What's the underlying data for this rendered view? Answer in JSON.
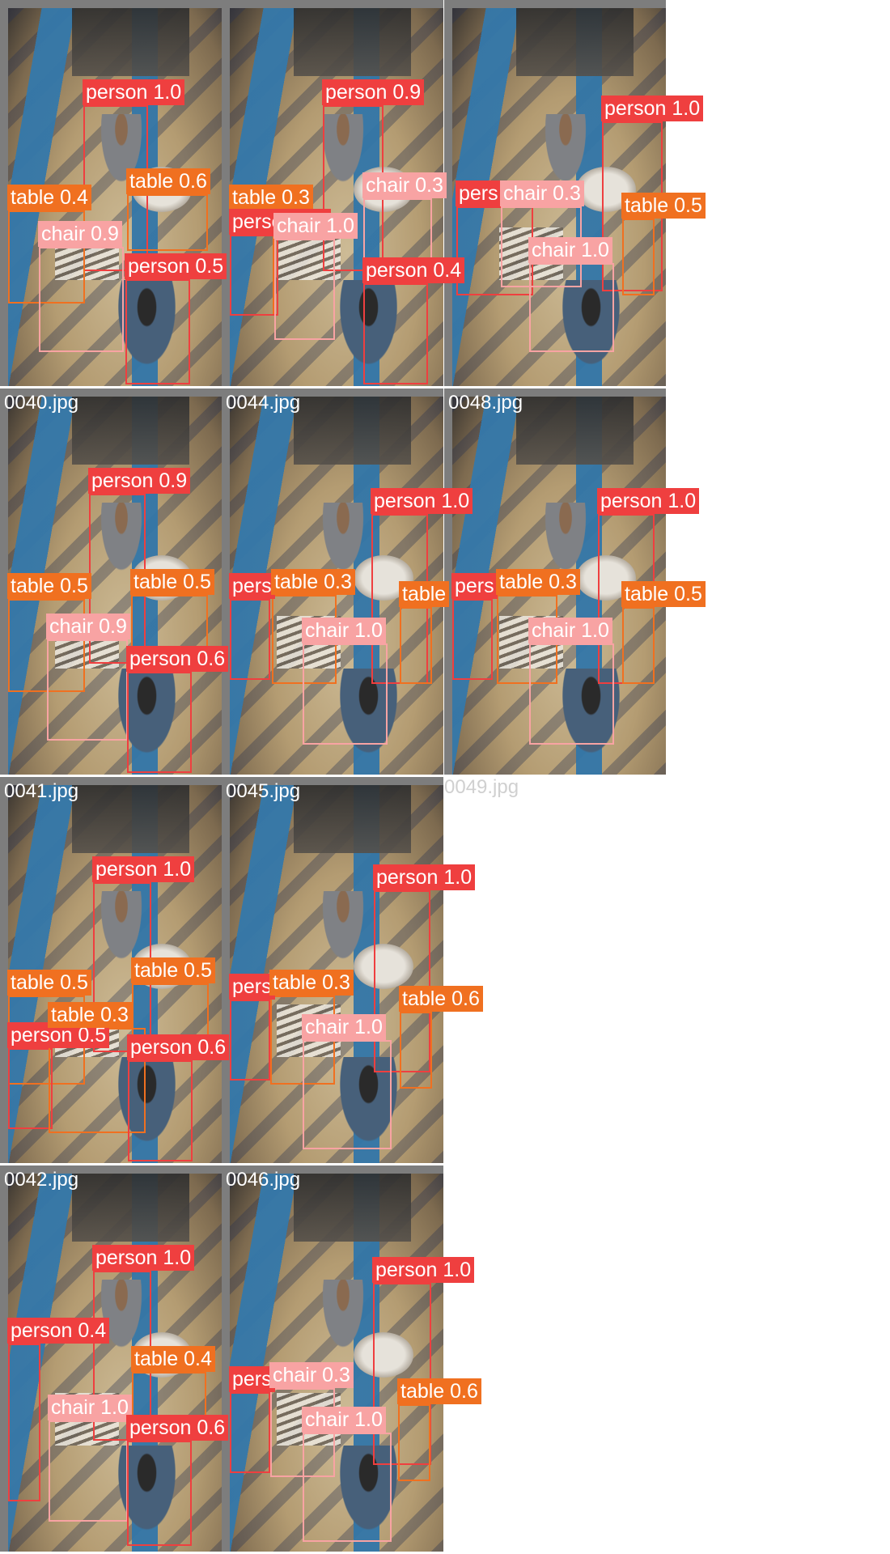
{
  "class_colors": {
    "person": "#ef3f3f",
    "table": "#f07020",
    "chair": "#f8a3a3"
  },
  "tiles": [
    {
      "filename": "",
      "detections": [
        {
          "label": "person 1.0",
          "cls": "person"
        },
        {
          "label": "table 0.4",
          "cls": "table"
        },
        {
          "label": "table 0.6",
          "cls": "table"
        },
        {
          "label": "chair 0.9",
          "cls": "chair"
        },
        {
          "label": "person 0.5",
          "cls": "person"
        }
      ]
    },
    {
      "filename": "",
      "detections": [
        {
          "label": "person 0.9",
          "cls": "person"
        },
        {
          "label": "table 0.3",
          "cls": "table"
        },
        {
          "label": "chair 0.3",
          "cls": "chair"
        },
        {
          "label": "person 0.5",
          "cls": "person"
        },
        {
          "label": "chair 1.0",
          "cls": "chair"
        },
        {
          "label": "person 0.4",
          "cls": "person"
        }
      ]
    },
    {
      "filename": "",
      "detections": [
        {
          "label": "person 1.0",
          "cls": "person"
        },
        {
          "label": "pers",
          "cls": "person"
        },
        {
          "label": "chair 0.3",
          "cls": "chair"
        },
        {
          "label": "table 0.5",
          "cls": "table"
        },
        {
          "label": "chair 1.0",
          "cls": "chair"
        }
      ]
    },
    {
      "filename": "0040.jpg",
      "detections": [
        {
          "label": "person 0.9",
          "cls": "person"
        },
        {
          "label": "table 0.5",
          "cls": "table"
        },
        {
          "label": "table 0.5",
          "cls": "table"
        },
        {
          "label": "chair 0.9",
          "cls": "chair"
        },
        {
          "label": "person 0.6",
          "cls": "person"
        }
      ]
    },
    {
      "filename": "0044.jpg",
      "detections": [
        {
          "label": "person 1.0",
          "cls": "person"
        },
        {
          "label": "pers",
          "cls": "person"
        },
        {
          "label": "table 0.3",
          "cls": "table"
        },
        {
          "label": "table",
          "cls": "table"
        },
        {
          "label": "chair 1.0",
          "cls": "chair"
        }
      ]
    },
    {
      "filename": "0048.jpg",
      "detections": [
        {
          "label": "person 1.0",
          "cls": "person"
        },
        {
          "label": "pers",
          "cls": "person"
        },
        {
          "label": "table 0.3",
          "cls": "table"
        },
        {
          "label": "table 0.5",
          "cls": "table"
        },
        {
          "label": "chair 1.0",
          "cls": "chair"
        }
      ]
    },
    {
      "filename": "0041.jpg",
      "detections": [
        {
          "label": "person 1.0",
          "cls": "person"
        },
        {
          "label": "table 0.5",
          "cls": "table"
        },
        {
          "label": "table 0.5",
          "cls": "table"
        },
        {
          "label": "person 0.5",
          "cls": "person"
        },
        {
          "label": "table 0.3",
          "cls": "table"
        },
        {
          "label": "person 0.6",
          "cls": "person"
        }
      ]
    },
    {
      "filename": "0045.jpg",
      "detections": [
        {
          "label": "person 1.0",
          "cls": "person"
        },
        {
          "label": "pers",
          "cls": "person"
        },
        {
          "label": "table 0.3",
          "cls": "table"
        },
        {
          "label": "table 0.6",
          "cls": "table"
        },
        {
          "label": "chair 1.0",
          "cls": "chair"
        }
      ]
    },
    {
      "filename": "0049.jpg",
      "empty": true,
      "detections": []
    },
    {
      "filename": "0042.jpg",
      "detections": [
        {
          "label": "person 1.0",
          "cls": "person"
        },
        {
          "label": "person 0.4",
          "cls": "person"
        },
        {
          "label": "table 0.4",
          "cls": "table"
        },
        {
          "label": "chair 1.0",
          "cls": "chair"
        },
        {
          "label": "person 0.6",
          "cls": "person"
        }
      ]
    },
    {
      "filename": "0046.jpg",
      "detections": [
        {
          "label": "person 1.0",
          "cls": "person"
        },
        {
          "label": "pers",
          "cls": "person"
        },
        {
          "label": "chair 0.3",
          "cls": "chair"
        },
        {
          "label": "table 0.6",
          "cls": "table"
        },
        {
          "label": "chair 1.0",
          "cls": "chair"
        }
      ]
    }
  ]
}
